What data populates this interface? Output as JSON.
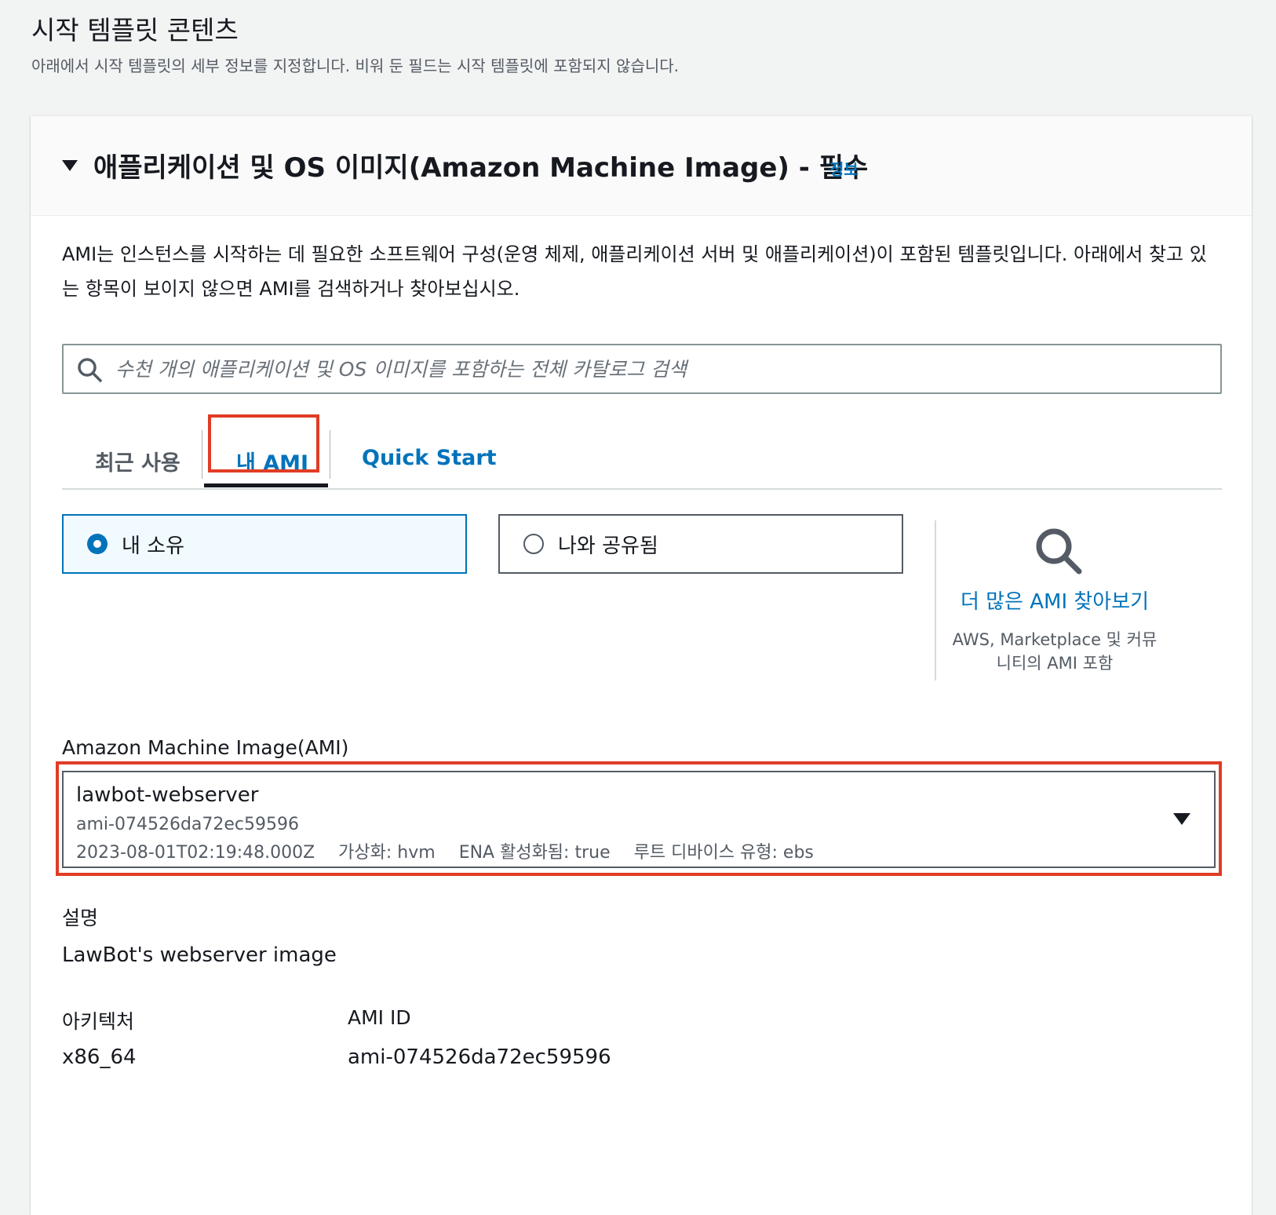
{
  "page": {
    "title": "시작 템플릿 콘텐츠",
    "description": "아래에서 시작 템플릿의 세부 정보를 지정합니다. 비워 둔 필드는 시작 템플릿에 포함되지 않습니다."
  },
  "ami_section": {
    "title": "애플리케이션 및 OS 이미지(Amazon Machine Image) - 필수",
    "info_link": "정보",
    "intro": "AMI는 인스턴스를 시작하는 데 필요한 소프트웨어 구성(운영 체제, 애플리케이션 서버 및 애플리케이션)이 포함된 템플릿입니다. 아래에서 찾고 있는 항목이 보이지 않으면 AMI를 검색하거나 찾아보십시오.",
    "search": {
      "placeholder": "수천 개의 애플리케이션 및 OS 이미지를 포함하는 전체 카탈로그 검색",
      "value": ""
    },
    "tabs": [
      {
        "label": "최근 사용",
        "active": false
      },
      {
        "label": "내 AMI",
        "active": true
      },
      {
        "label": "Quick Start",
        "active": false
      }
    ],
    "ownership": {
      "options": [
        {
          "label": "내 소유",
          "selected": true
        },
        {
          "label": "나와 공유됨",
          "selected": false
        }
      ]
    },
    "browse": {
      "link": "더 많은 AMI 찾아보기",
      "subtext": "AWS, Marketplace 및 커뮤니티의 AMI 포함"
    },
    "ami_select": {
      "label": "Amazon Machine Image(AMI)",
      "name": "lawbot-webserver",
      "id": "ami-074526da72ec59596",
      "created": "2023-08-01T02:19:48.000Z",
      "virtualization": "가상화: hvm",
      "ena": "ENA 활성화됨: true",
      "root_device": "루트 디바이스 유형: ebs"
    },
    "details": {
      "description_label": "설명",
      "description_value": "LawBot's webserver image",
      "architecture_label": "아키텍처",
      "architecture_value": "x86_64",
      "ami_id_label": "AMI ID",
      "ami_id_value": "ami-074526da72ec59596"
    }
  },
  "colors": {
    "link": "#0073bb",
    "highlight": "#e03c24",
    "selected_bg": "#f1faff",
    "page_bg": "#f2f3f3"
  },
  "icons": [
    "caret-down-icon",
    "search-icon",
    "magnifier-icon",
    "dropdown-caret-icon"
  ]
}
